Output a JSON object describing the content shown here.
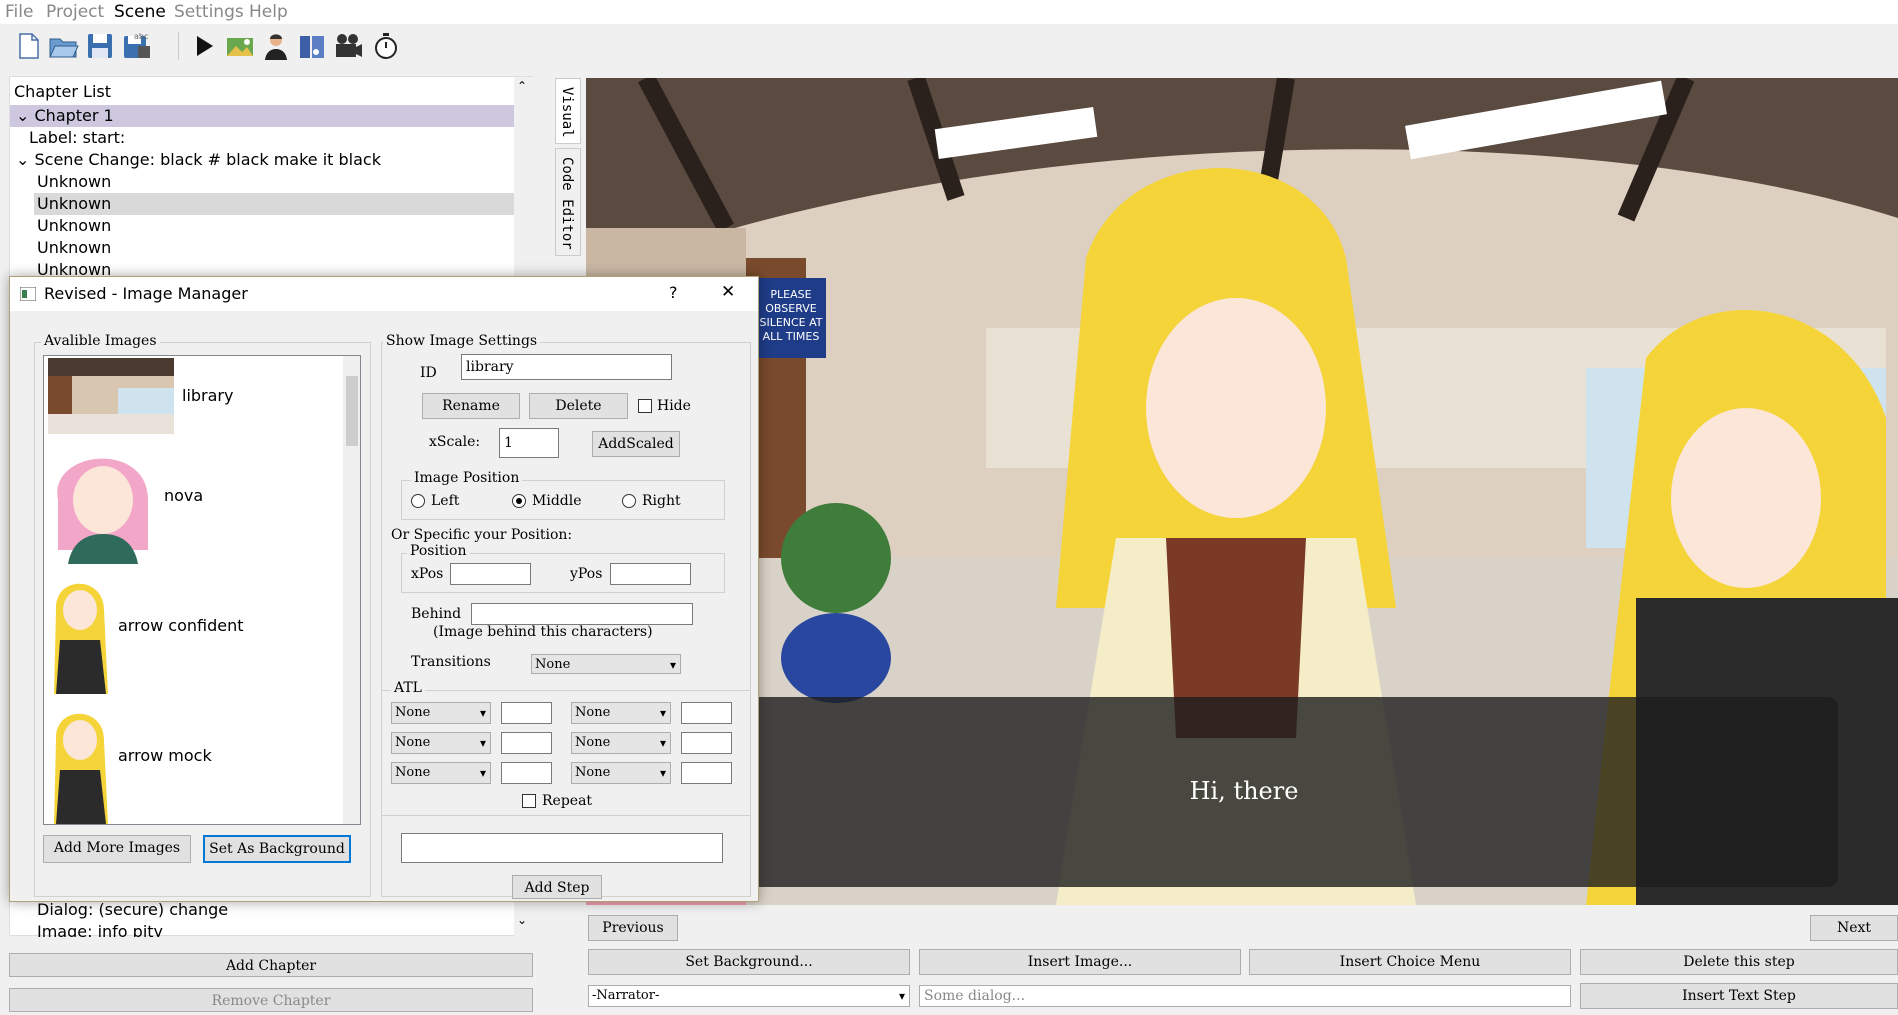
{
  "menu": {
    "file": "File",
    "project": "Project",
    "scene": "Scene",
    "settings": "Settings",
    "help": "Help"
  },
  "toolbar": {
    "icons": [
      "new-file-icon",
      "open-folder-icon",
      "save-icon",
      "save-as-icon",
      "play-icon",
      "scene-icon",
      "character-icon",
      "music-icon",
      "camera-icon",
      "timer-icon"
    ]
  },
  "chapter_list": {
    "header": "Chapter List",
    "rows": [
      {
        "label": "Chapter 1",
        "selected": true
      },
      {
        "label": "Label: start:"
      },
      {
        "label": "Scene Change: black # black make it black"
      },
      {
        "label": "Unknown"
      },
      {
        "label": "Unknown",
        "highlight": true
      },
      {
        "label": "Unknown"
      },
      {
        "label": "Unknown"
      },
      {
        "label": "Unknown"
      }
    ],
    "bottom_rows": [
      "Dialog: (secure) change",
      "Image: info pity"
    ],
    "add_chapter": "Add Chapter",
    "remove_chapter": "Remove Chapter"
  },
  "tabs": {
    "visual": "Visual",
    "code_editor": "Code Editor"
  },
  "scene": {
    "sign_text": "PLEASE OBSERVE SILENCE AT ALL TIMES",
    "dialog_text": "Hi, there"
  },
  "controls": {
    "previous": "Previous",
    "next": "Next",
    "set_background": "Set Background...",
    "insert_image": "Insert Image...",
    "insert_choice_menu": "Insert Choice Menu",
    "delete_step": "Delete this step",
    "narrator": "-Narrator-",
    "dialog_placeholder": "Some dialog...",
    "insert_text_step": "Insert Text Step"
  },
  "image_manager": {
    "title": "Revised - Image Manager",
    "help_glyph": "?",
    "close_glyph": "✕",
    "available_title": "Avalible Images",
    "images": [
      {
        "name": "library"
      },
      {
        "name": "nova"
      },
      {
        "name": "arrow confident"
      },
      {
        "name": "arrow mock"
      }
    ],
    "add_more": "Add More Images",
    "set_as_background": "Set As Background",
    "settings_title": "Show Image Settings",
    "id_label": "ID",
    "id_value": "library",
    "rename": "Rename",
    "delete": "Delete",
    "hide": "Hide",
    "xscale_label": "xScale:",
    "xscale_value": "1",
    "add_scaled": "AddScaled",
    "position_title": "Image Position",
    "pos_left": "Left",
    "pos_middle": "Middle",
    "pos_right": "Right",
    "specific_label": "Or Specific your Position:",
    "position_sub": "Position",
    "xpos_label": "xPos",
    "ypos_label": "yPos",
    "behind_label": "Behind",
    "behind_hint": "(Image behind this characters)",
    "transitions_label": "Transitions",
    "transitions_value": "None",
    "atl_title": "ATL",
    "atl_value": "None",
    "repeat": "Repeat",
    "add_step": "Add Step"
  }
}
